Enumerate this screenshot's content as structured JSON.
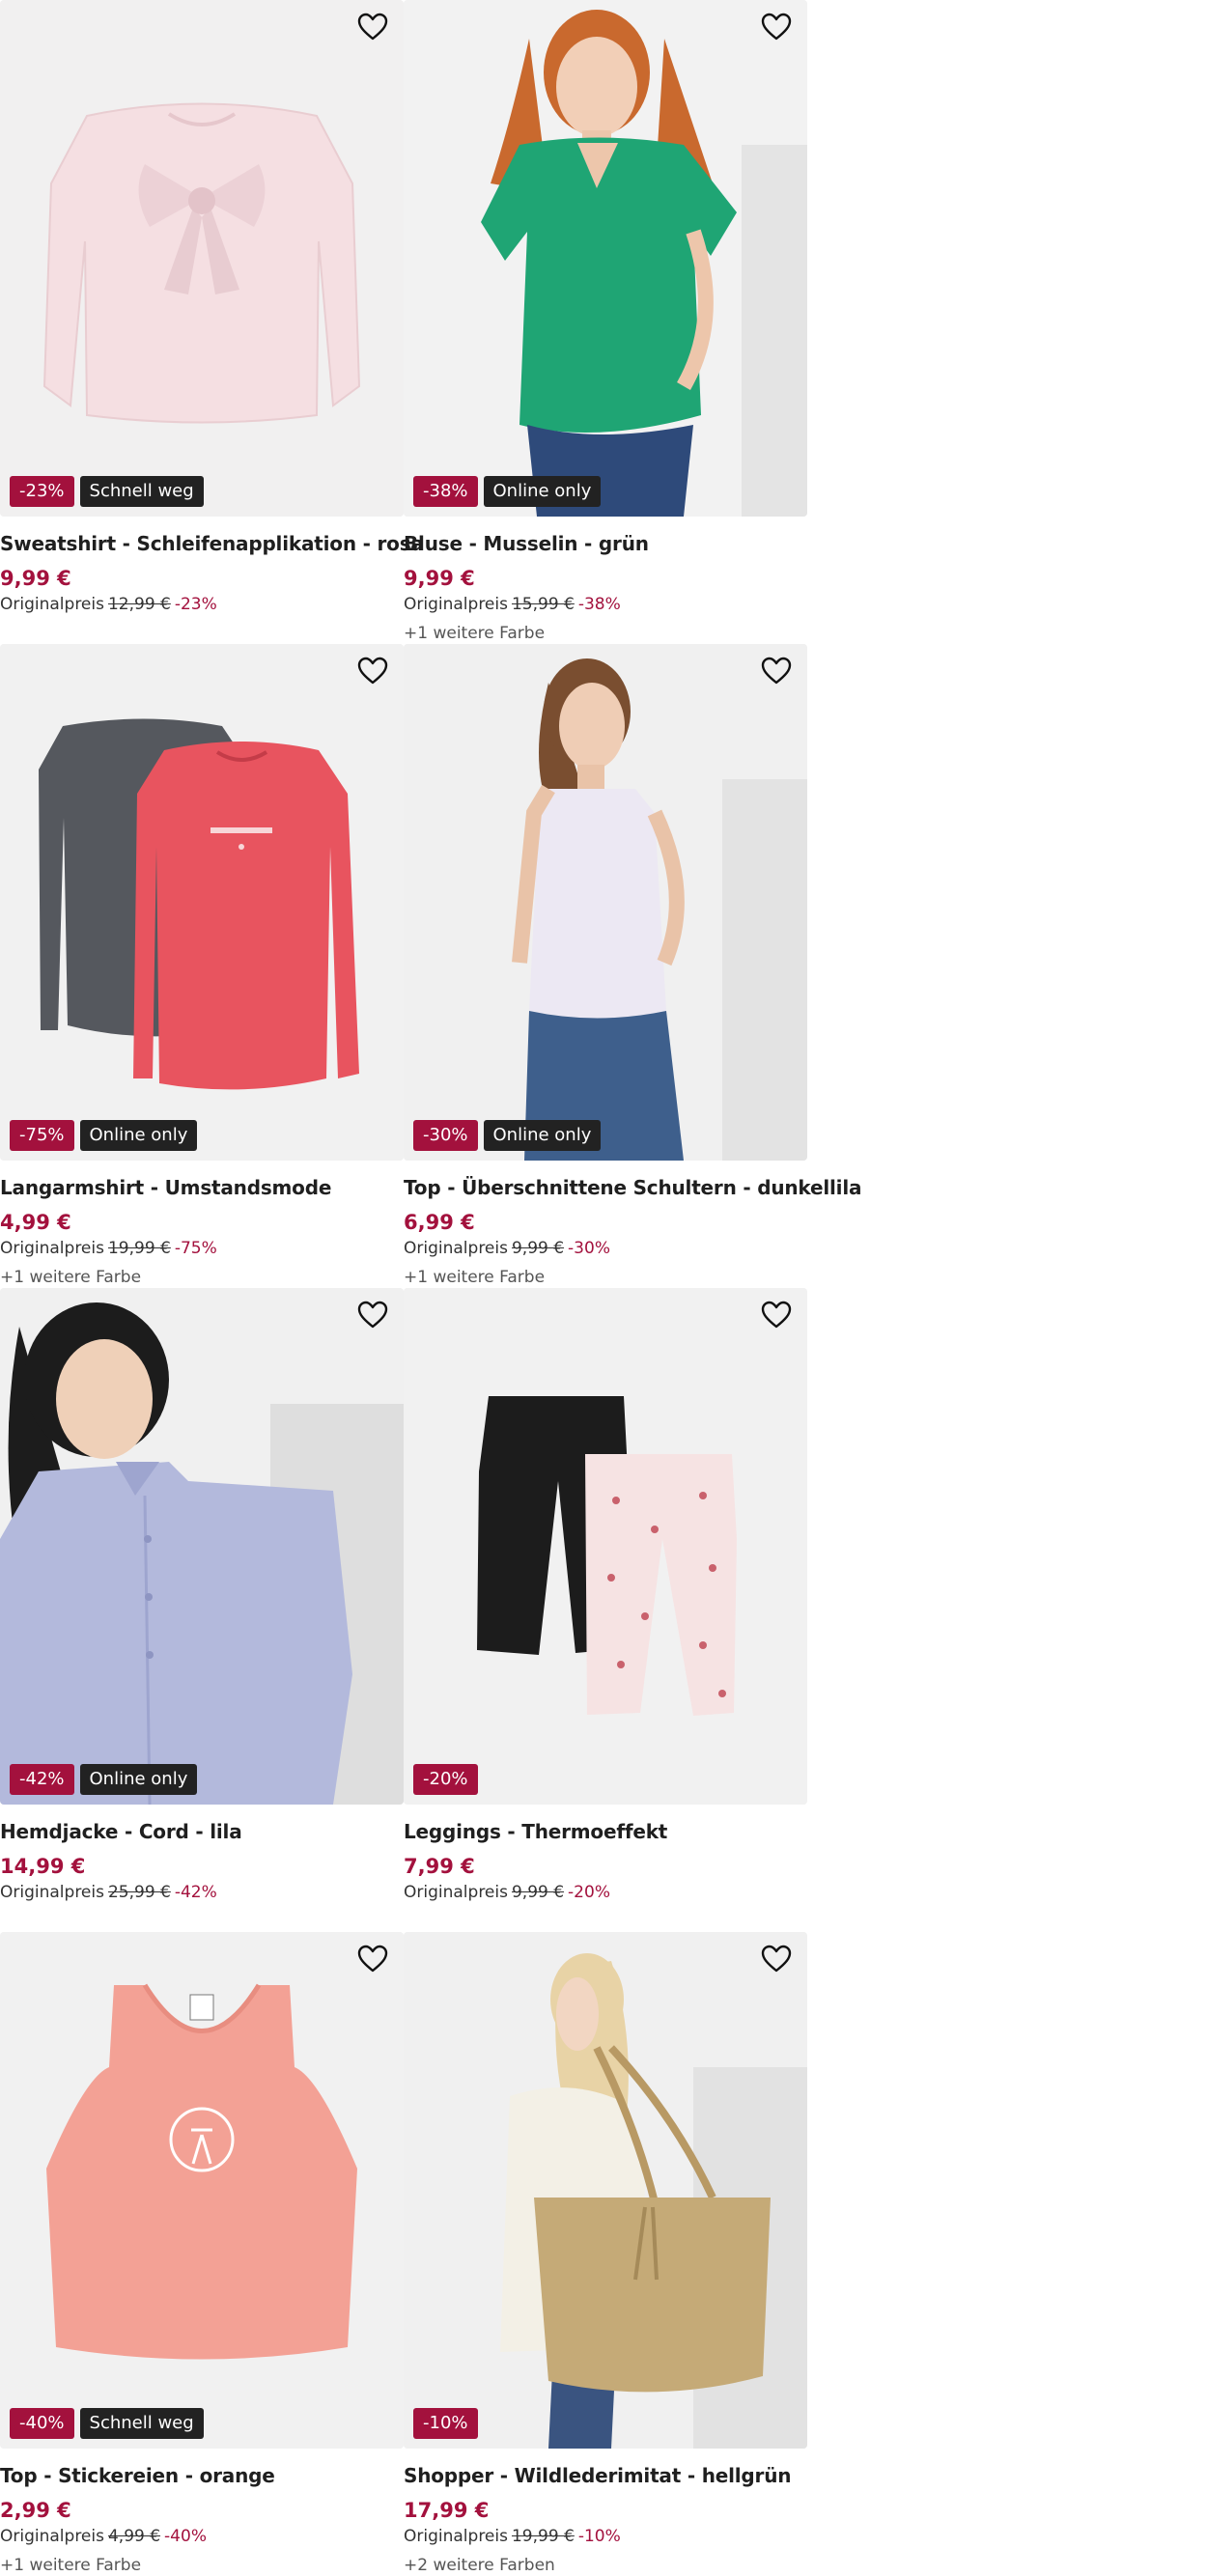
{
  "colors": {
    "price": "#a3113d",
    "discount_badge": "#a3113d",
    "tag_badge": "#222222",
    "image_bg": "#efefef"
  },
  "labels": {
    "original_price": "Originalpreis",
    "favorite_icon": "heart-outline-icon"
  },
  "products": [
    {
      "title": "Sweatshirt - Schleifenapplikation - rosa",
      "price": "9,99 €",
      "old_price": "12,99 €",
      "discount": "-23%",
      "tag": "Schnell weg",
      "colors": ""
    },
    {
      "title": "Bluse - Musselin - grün",
      "price": "9,99 €",
      "old_price": "15,99 €",
      "discount": "-38%",
      "tag": "Online only",
      "colors": "+1 weitere Farbe"
    },
    {
      "title": "Langarmshirt - Umstandsmode",
      "price": "4,99 €",
      "old_price": "19,99 €",
      "discount": "-75%",
      "tag": "Online only",
      "colors": "+1 weitere Farbe"
    },
    {
      "title": "Top - Überschnittene Schultern - dunkellila",
      "price": "6,99 €",
      "old_price": "9,99 €",
      "discount": "-30%",
      "tag": "Online only",
      "colors": "+1 weitere Farbe"
    },
    {
      "title": "Hemdjacke - Cord - lila",
      "price": "14,99 €",
      "old_price": "25,99 €",
      "discount": "-42%",
      "tag": "Online only",
      "colors": ""
    },
    {
      "title": "Leggings - Thermoeffekt",
      "price": "7,99 €",
      "old_price": "9,99 €",
      "discount": "-20%",
      "tag": "",
      "colors": ""
    },
    {
      "title": "Top - Stickereien - orange",
      "price": "2,99 €",
      "old_price": "4,99 €",
      "discount": "-40%",
      "tag": "Schnell weg",
      "colors": "+1 weitere Farbe"
    },
    {
      "title": "Shopper - Wildlederimitat - hellgrün",
      "price": "17,99 €",
      "old_price": "19,99 €",
      "discount": "-10%",
      "tag": "",
      "colors": "+2 weitere Farben"
    }
  ]
}
